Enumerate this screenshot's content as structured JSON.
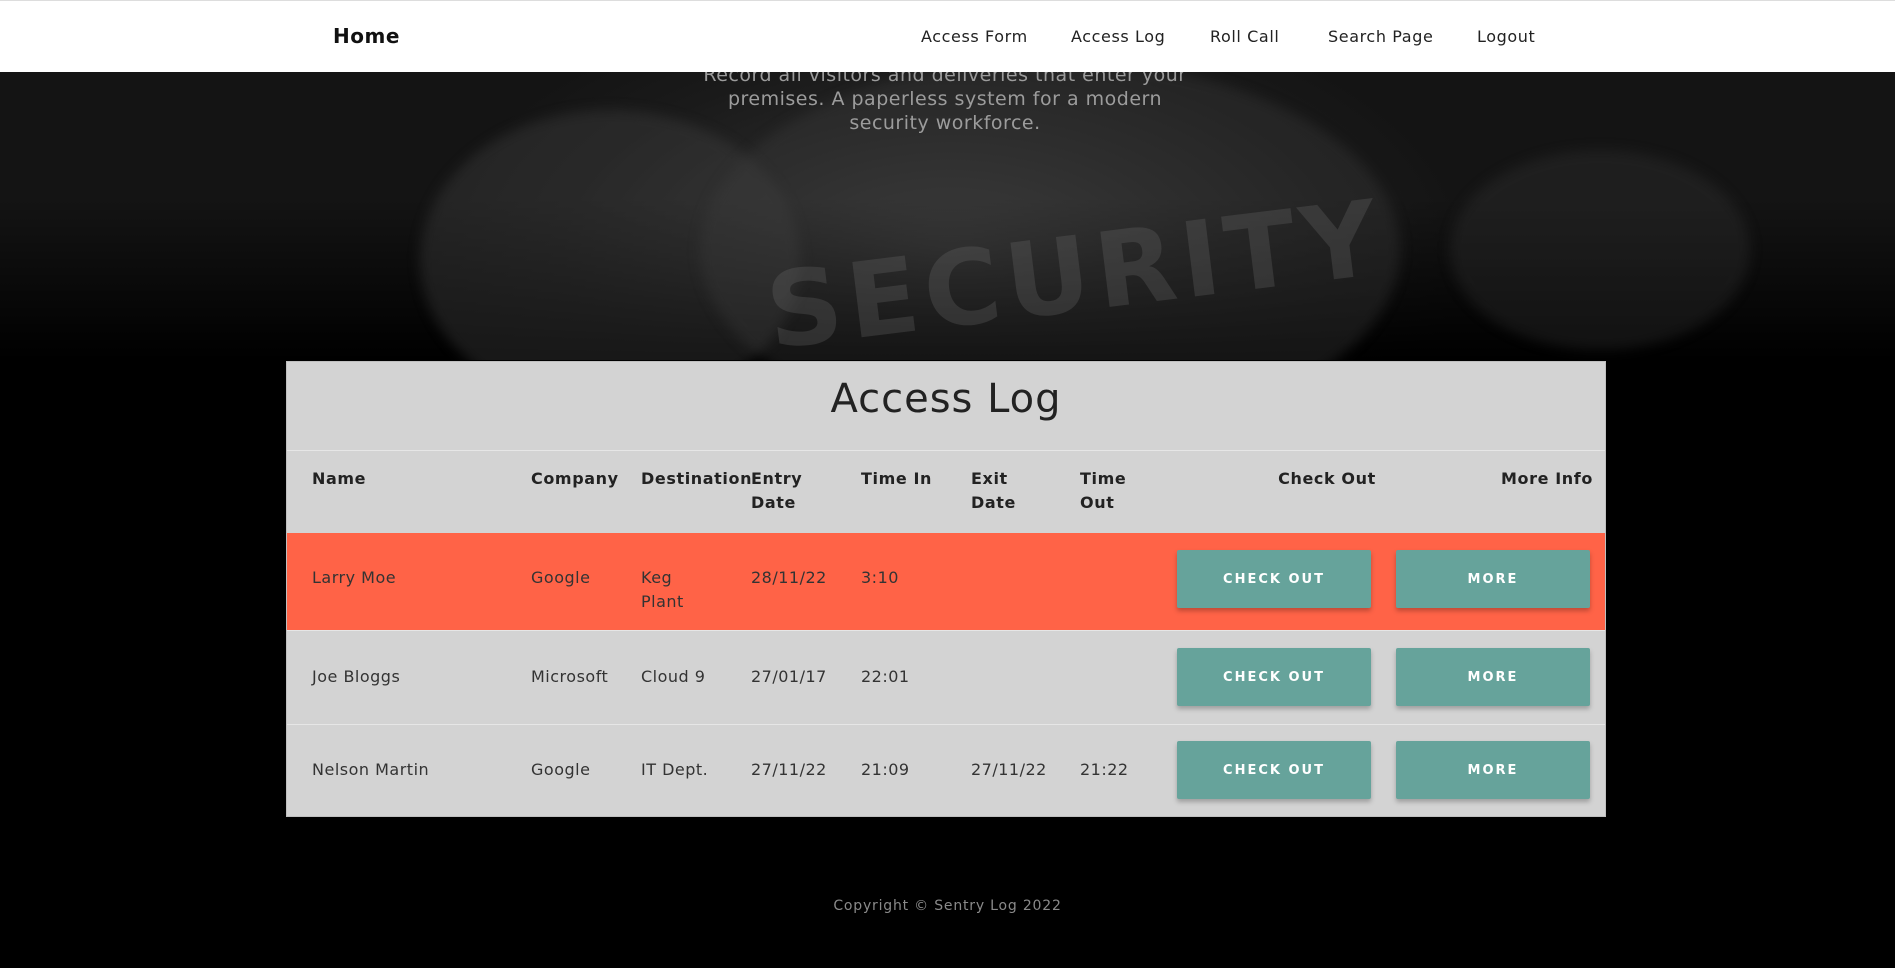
{
  "nav": {
    "brand": "Home",
    "links": [
      "Access Form",
      "Access Log",
      "Roll Call",
      "Search Page",
      "Logout"
    ]
  },
  "hero": {
    "tagline_lines": [
      "Record all visitors and deliveries that enter your",
      "premises. A paperless system for a modern",
      "security workforce."
    ],
    "watermark": "SECURITY"
  },
  "access_log": {
    "title": "Access Log",
    "columns": [
      "Name",
      "Company",
      "Destination",
      "Entry\nDate",
      "Time In",
      "Exit\nDate",
      "Time\nOut",
      "Check Out",
      "More Info"
    ],
    "rows": [
      {
        "name": "Larry Moe",
        "company": "Google",
        "destination": "Keg\nPlant",
        "entry_date": "28/11/22",
        "time_in": "3:10",
        "exit_date": "",
        "time_out": "",
        "checkout_label": "CHECK OUT",
        "more_label": "MORE",
        "highlighted": true
      },
      {
        "name": "Joe Bloggs",
        "company": "Microsoft",
        "destination": "Cloud 9",
        "entry_date": "27/01/17",
        "time_in": "22:01",
        "exit_date": "",
        "time_out": "",
        "checkout_label": "CHECK OUT",
        "more_label": "MORE",
        "highlighted": false
      },
      {
        "name": "Nelson Martin",
        "company": "Google",
        "destination": "IT Dept.",
        "entry_date": "27/11/22",
        "time_in": "21:09",
        "exit_date": "27/11/22",
        "time_out": "21:22",
        "checkout_label": "CHECK OUT",
        "more_label": "MORE",
        "highlighted": false
      }
    ]
  },
  "footer": {
    "copyright": "Copyright © Sentry Log 2022"
  },
  "colors": {
    "highlight_row": "#ff6347",
    "button": "#66a39b",
    "card_bg": "#d3d3d3"
  }
}
